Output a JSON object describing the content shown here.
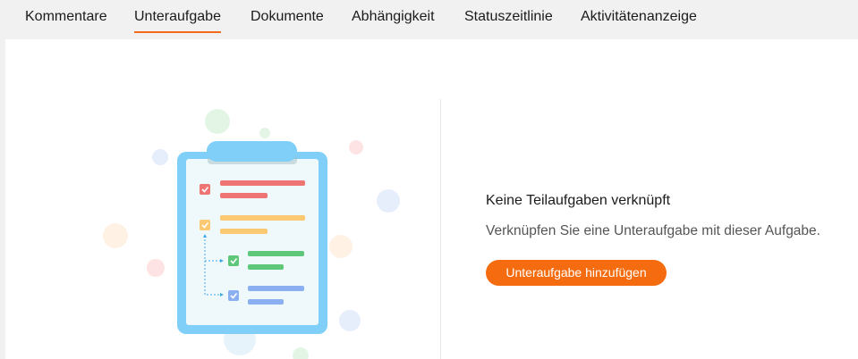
{
  "tabs": [
    {
      "label": "Kommentare"
    },
    {
      "label": "Unteraufgabe"
    },
    {
      "label": "Dokumente"
    },
    {
      "label": "Abhängigkeit"
    },
    {
      "label": "Statuszeitlinie"
    },
    {
      "label": "Aktivitätenanzeige"
    }
  ],
  "active_tab": "Unteraufgabe",
  "empty_state": {
    "title": "Keine Teilaufgaben verknüpft",
    "description": "Verknüpfen Sie eine Unteraufgabe mit dieser Aufgabe.",
    "button_label": "Unteraufgabe hinzufügen"
  },
  "colors": {
    "accent": "#f26b1d",
    "button": "#f56b0f",
    "clipboard": "#7fcff8",
    "check_red": "#ef7474",
    "check_yellow": "#fbc972",
    "check_green": "#5fc77a",
    "check_blue": "#8ab0f2"
  },
  "icons": [
    "clipboard-checklist-illustration",
    "checkbox-icon"
  ]
}
